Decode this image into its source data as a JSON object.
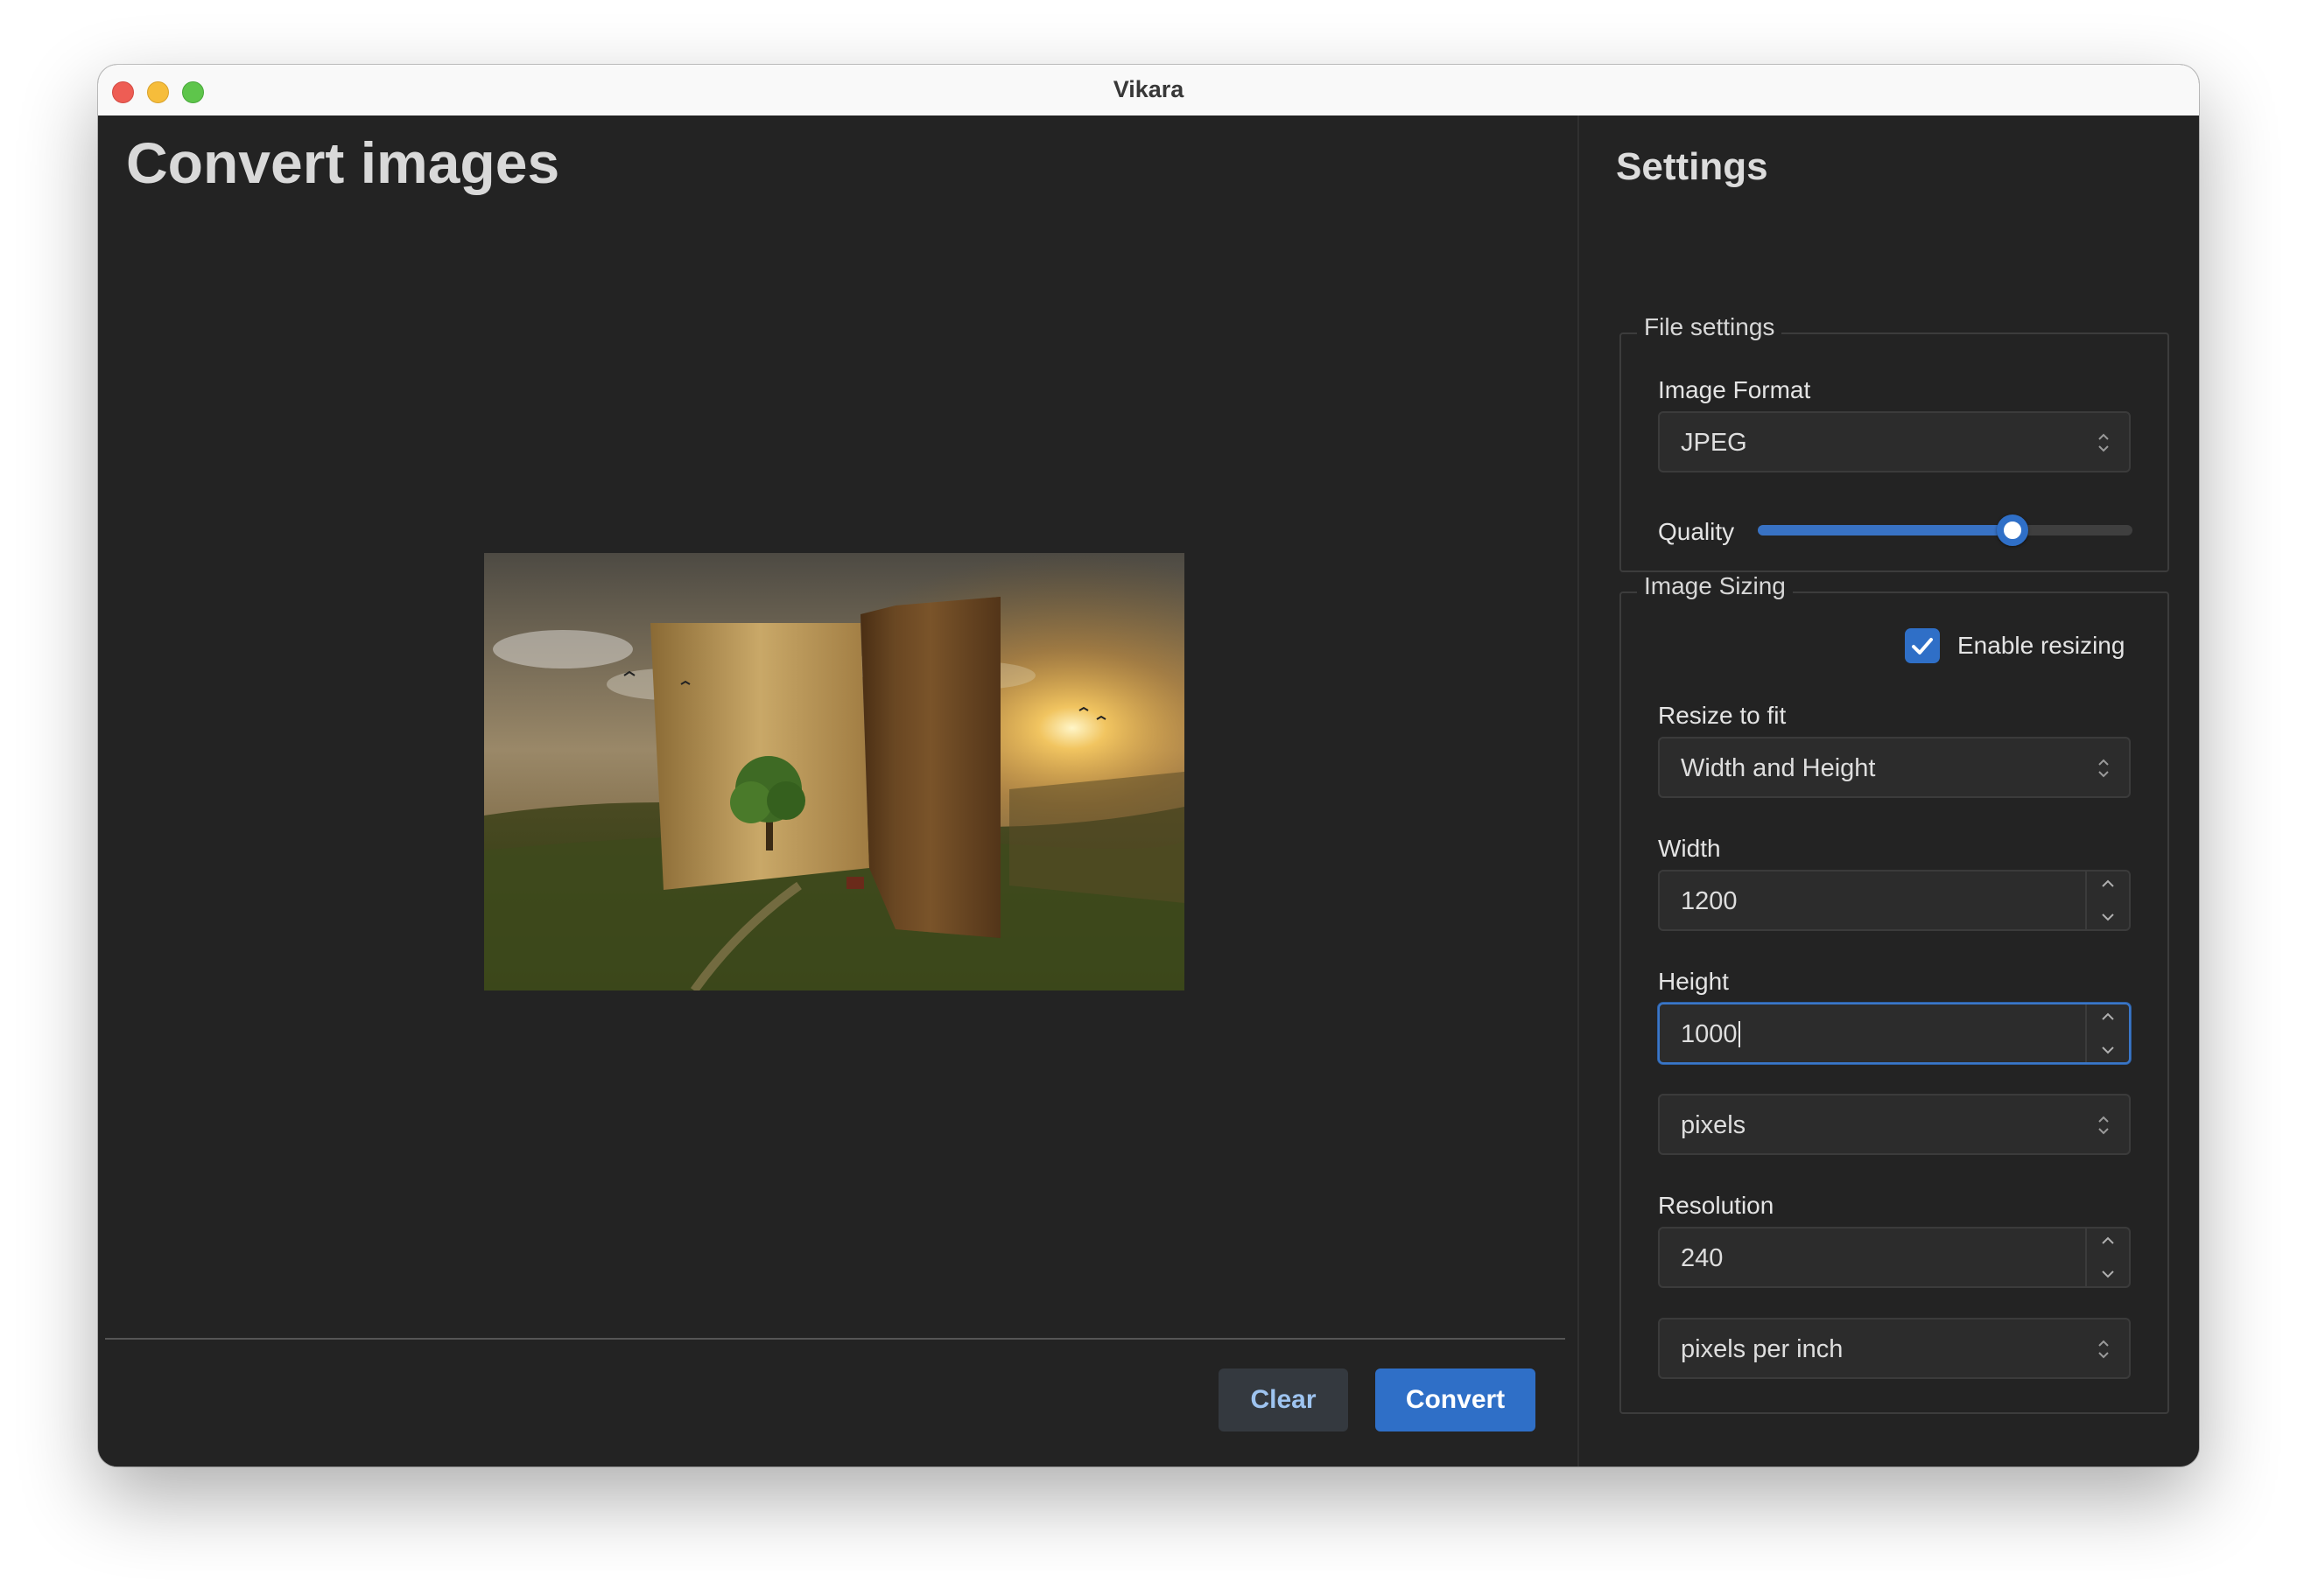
{
  "window": {
    "title": "Vikara"
  },
  "main": {
    "title": "Convert images",
    "buttons": {
      "clear": "Clear",
      "convert": "Convert"
    }
  },
  "settings": {
    "title": "Settings",
    "file_settings": {
      "legend": "File settings",
      "image_format_label": "Image Format",
      "image_format_value": "JPEG",
      "quality_label": "Quality",
      "quality_fraction": 0.68
    },
    "image_sizing": {
      "legend": "Image Sizing",
      "enable_resizing_label": "Enable resizing",
      "enable_resizing_checked": true,
      "resize_to_fit_label": "Resize to fit",
      "resize_to_fit_value": "Width and Height",
      "width_label": "Width",
      "width_value": "1200",
      "height_label": "Height",
      "height_value": "1000",
      "size_unit_value": "pixels",
      "resolution_label": "Resolution",
      "resolution_value": "240",
      "resolution_unit_value": "pixels per inch"
    }
  },
  "colors": {
    "accent": "#2f6fc7",
    "window_bg": "#232323",
    "control_bg": "#2c2c2c",
    "traffic_close": "#ee5d54",
    "traffic_minimize": "#f6bd3b",
    "traffic_zoom": "#5ec54b"
  }
}
